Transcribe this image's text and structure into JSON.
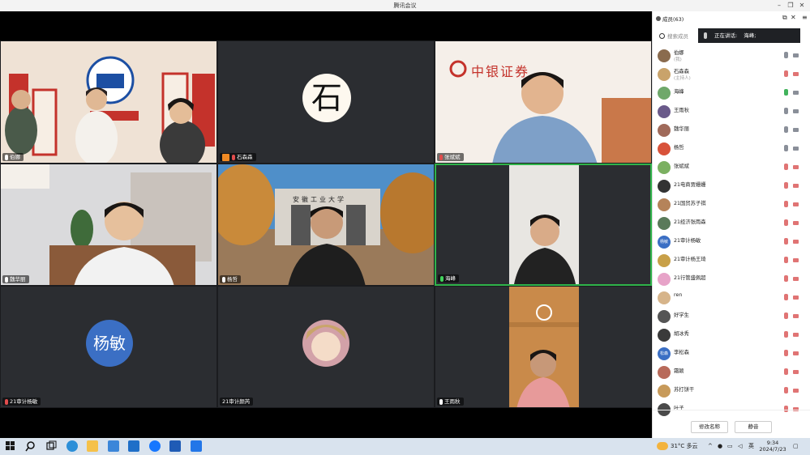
{
  "window": {
    "title": "腾讯会议"
  },
  "tiles": [
    {
      "name": "伯娜",
      "mic": "on"
    },
    {
      "name": "石森森",
      "mic": "muted",
      "host": true,
      "avatar_text": "石"
    },
    {
      "name": "张斌斌",
      "mic": "muted",
      "banner": "中银证券"
    },
    {
      "name": "魏华丽",
      "mic": "on"
    },
    {
      "name": "杨哲",
      "mic": "on",
      "gate_text": "安徽工业大学"
    },
    {
      "name": "海峰",
      "mic": "speaking"
    },
    {
      "name": "21审计杨敏",
      "mic": "muted",
      "avatar_text": "杨敏"
    },
    {
      "name": "21审计颜芮",
      "mic": "none"
    },
    {
      "name": "王雨秋",
      "mic": "on"
    }
  ],
  "sidebar": {
    "members_label": "成员(63)",
    "search_placeholder": "搜索成员",
    "speaking_label": "正在讲话:",
    "speaking_name": "海峰;",
    "members": [
      {
        "name": "伯娜",
        "sub": "(我)",
        "avatar_color": "#8a6b4e",
        "mic": "#8a8f99",
        "cam": "#8a8f99"
      },
      {
        "name": "石森森",
        "sub": "(主持人)",
        "avatar_color": "#c9a36b",
        "mic": "#e07474",
        "cam": "#e07474"
      },
      {
        "name": "海峰",
        "avatar_color": "#6fa86a",
        "mic": "#41b35c",
        "cam": "#8a8f99"
      },
      {
        "name": "王雨秋",
        "avatar_color": "#6a5a8a",
        "mic": "#8a8f99",
        "cam": "#8a8f99"
      },
      {
        "name": "魏华丽",
        "avatar_color": "#a06a5a",
        "mic": "#8a8f99",
        "cam": "#8a8f99"
      },
      {
        "name": "杨哲",
        "avatar_color": "#d8523a",
        "mic": "#8a8f99",
        "cam": "#8a8f99"
      },
      {
        "name": "张斌斌",
        "avatar_color": "#7bb061",
        "mic": "#e07474",
        "cam": "#e07474"
      },
      {
        "name": "21电商贾姗姗",
        "avatar_color": "#333333",
        "mic": "#e07474",
        "cam": "#e07474"
      },
      {
        "name": "21国贸苏子祺",
        "avatar_color": "#b5835a",
        "mic": "#e07474",
        "cam": "#e07474"
      },
      {
        "name": "21经济张雨森",
        "avatar_color": "#5a7a5a",
        "mic": "#e07474",
        "cam": "#e07474"
      },
      {
        "name": "21审计杨敏",
        "avatar_text": "杨敏",
        "avatar_color": "#3b6fc4",
        "mic": "#e07474",
        "cam": "#e07474"
      },
      {
        "name": "21审计杨王琦",
        "avatar_color": "#c8a048",
        "mic": "#e07474",
        "cam": "#e07474"
      },
      {
        "name": "21行管盛佩超",
        "avatar_color": "#e7a3c8",
        "mic": "#e07474",
        "cam": "#e07474"
      },
      {
        "name": "ren",
        "avatar_color": "#d6b48a",
        "mic": "#e07474",
        "cam": "#e07474"
      },
      {
        "name": "好学生",
        "avatar_color": "#555555",
        "mic": "#e07474",
        "cam": "#e07474"
      },
      {
        "name": "胡冰秀",
        "avatar_color": "#3a3a3a",
        "mic": "#e07474",
        "cam": "#e07474"
      },
      {
        "name": "李松森",
        "avatar_text": "松森",
        "avatar_color": "#3b6fc4",
        "mic": "#e07474",
        "cam": "#e07474"
      },
      {
        "name": "霜颖",
        "avatar_color": "#b86a5a",
        "mic": "#e07474",
        "cam": "#e07474"
      },
      {
        "name": "苏打饼干",
        "avatar_color": "#c79a5a",
        "mic": "#e07474",
        "cam": "#e07474"
      },
      {
        "name": "叶子",
        "avatar_color": "#4a4a4a",
        "mic": "#e07474",
        "cam": "#e07474"
      }
    ],
    "rename_button": "修改名称",
    "mute_button": "静音"
  },
  "taskbar": {
    "weather": "31°C 多云",
    "ime": "英",
    "time": "9:34",
    "date": "2024/7/23"
  }
}
